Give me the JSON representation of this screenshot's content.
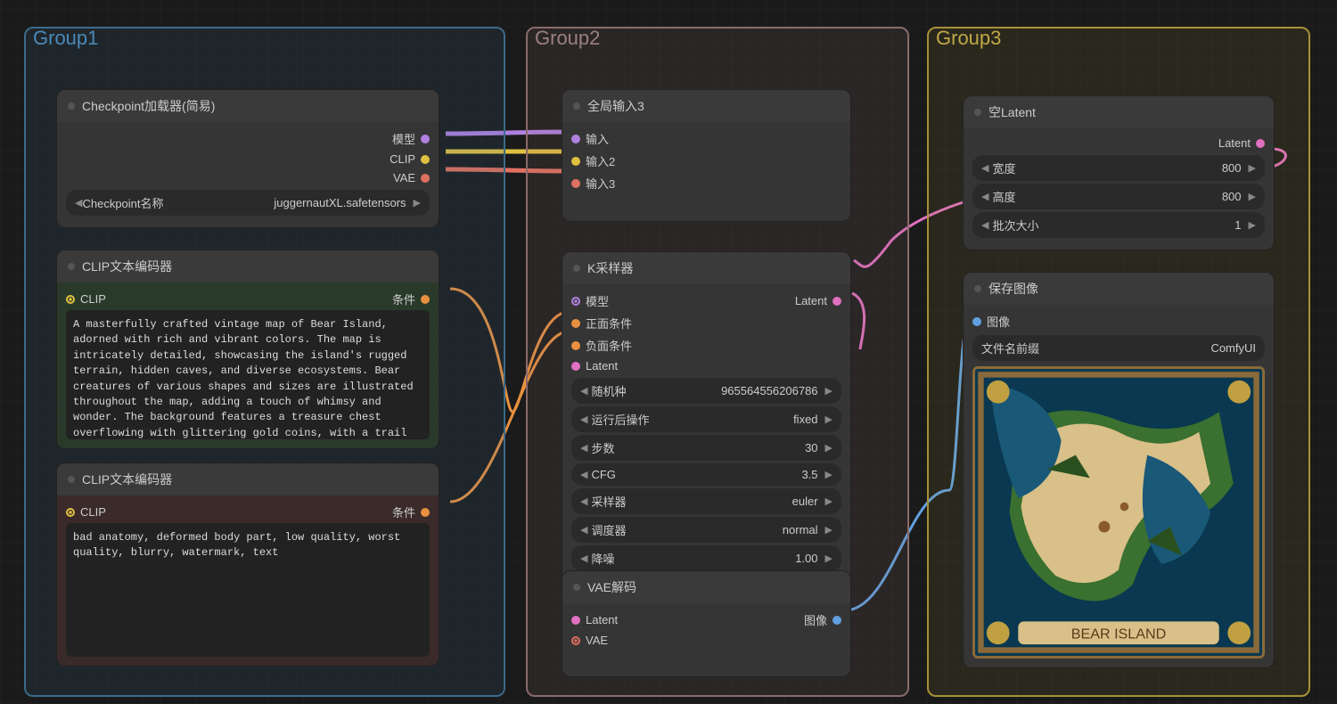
{
  "groups": {
    "g1": "Group1",
    "g2": "Group2",
    "g3": "Group3"
  },
  "checkpoint": {
    "title": "Checkpoint加载器(简易)",
    "out_model": "模型",
    "out_clip": "CLIP",
    "out_vae": "VAE",
    "widget_label": "Checkpoint名称",
    "widget_value": "juggernautXL.safetensors"
  },
  "clip_pos": {
    "title": "CLIP文本编码器",
    "in": "CLIP",
    "out": "条件",
    "text": "A masterfully crafted vintage map of Bear Island, adorned with rich and vibrant colors. The map is intricately detailed, showcasing the island's rugged terrain, hidden caves, and diverse ecosystems. Bear creatures of various shapes and sizes are illustrated throughout the map, adding a touch of whimsy and wonder. The background features a treasure chest overflowing with glittering gold coins, with a trail of faint footsteps leading from the chest to the island's edge. The atmosphere of the image is a captivating blend of historical charm, adventure, and excitement, transporting the viewer to a time of thrilling"
  },
  "clip_neg": {
    "title": "CLIP文本编码器",
    "in": "CLIP",
    "out": "条件",
    "text": "bad anatomy, deformed body part, low quality, worst quality, blurry, watermark, text"
  },
  "global_in": {
    "title": "全局输入3",
    "in1": "输入",
    "in2": "输入2",
    "in3": "输入3"
  },
  "ksampler": {
    "title": "K采样器",
    "in_model": "模型",
    "in_pos": "正面条件",
    "in_neg": "负面条件",
    "in_latent": "Latent",
    "out_latent": "Latent",
    "params": [
      {
        "label": "随机种",
        "value": "965564556206786"
      },
      {
        "label": "运行后操作",
        "value": "fixed"
      },
      {
        "label": "步数",
        "value": "30"
      },
      {
        "label": "CFG",
        "value": "3.5"
      },
      {
        "label": "采样器",
        "value": "euler"
      },
      {
        "label": "调度器",
        "value": "normal"
      },
      {
        "label": "降噪",
        "value": "1.00"
      }
    ]
  },
  "vae_dec": {
    "title": "VAE解码",
    "in_latent": "Latent",
    "in_vae": "VAE",
    "out": "图像"
  },
  "empty_latent": {
    "title": "空Latent",
    "out": "Latent",
    "params": [
      {
        "label": "宽度",
        "value": "800"
      },
      {
        "label": "高度",
        "value": "800"
      },
      {
        "label": "批次大小",
        "value": "1"
      }
    ]
  },
  "save_img": {
    "title": "保存图像",
    "in": "图像",
    "widget_label": "文件名前缀",
    "widget_value": "ComfyUI",
    "banner": "BEAR ISLAND"
  }
}
